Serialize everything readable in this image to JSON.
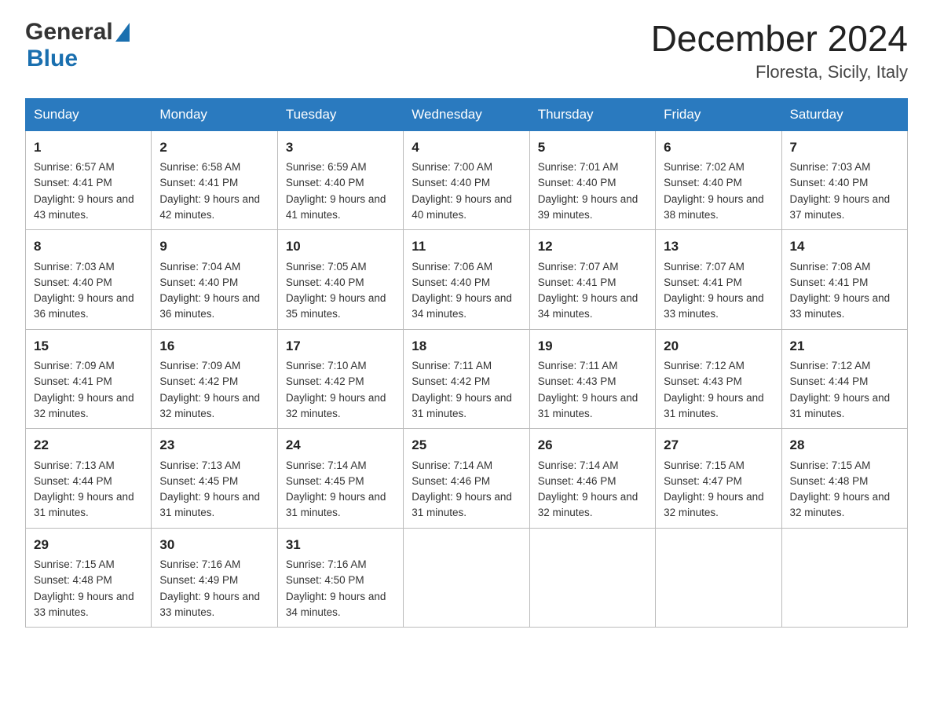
{
  "header": {
    "logo_general": "General",
    "logo_blue": "Blue",
    "month_year": "December 2024",
    "location": "Floresta, Sicily, Italy"
  },
  "days_of_week": [
    "Sunday",
    "Monday",
    "Tuesday",
    "Wednesday",
    "Thursday",
    "Friday",
    "Saturday"
  ],
  "weeks": [
    [
      {
        "day": "1",
        "sunrise": "Sunrise: 6:57 AM",
        "sunset": "Sunset: 4:41 PM",
        "daylight": "Daylight: 9 hours and 43 minutes."
      },
      {
        "day": "2",
        "sunrise": "Sunrise: 6:58 AM",
        "sunset": "Sunset: 4:41 PM",
        "daylight": "Daylight: 9 hours and 42 minutes."
      },
      {
        "day": "3",
        "sunrise": "Sunrise: 6:59 AM",
        "sunset": "Sunset: 4:40 PM",
        "daylight": "Daylight: 9 hours and 41 minutes."
      },
      {
        "day": "4",
        "sunrise": "Sunrise: 7:00 AM",
        "sunset": "Sunset: 4:40 PM",
        "daylight": "Daylight: 9 hours and 40 minutes."
      },
      {
        "day": "5",
        "sunrise": "Sunrise: 7:01 AM",
        "sunset": "Sunset: 4:40 PM",
        "daylight": "Daylight: 9 hours and 39 minutes."
      },
      {
        "day": "6",
        "sunrise": "Sunrise: 7:02 AM",
        "sunset": "Sunset: 4:40 PM",
        "daylight": "Daylight: 9 hours and 38 minutes."
      },
      {
        "day": "7",
        "sunrise": "Sunrise: 7:03 AM",
        "sunset": "Sunset: 4:40 PM",
        "daylight": "Daylight: 9 hours and 37 minutes."
      }
    ],
    [
      {
        "day": "8",
        "sunrise": "Sunrise: 7:03 AM",
        "sunset": "Sunset: 4:40 PM",
        "daylight": "Daylight: 9 hours and 36 minutes."
      },
      {
        "day": "9",
        "sunrise": "Sunrise: 7:04 AM",
        "sunset": "Sunset: 4:40 PM",
        "daylight": "Daylight: 9 hours and 36 minutes."
      },
      {
        "day": "10",
        "sunrise": "Sunrise: 7:05 AM",
        "sunset": "Sunset: 4:40 PM",
        "daylight": "Daylight: 9 hours and 35 minutes."
      },
      {
        "day": "11",
        "sunrise": "Sunrise: 7:06 AM",
        "sunset": "Sunset: 4:40 PM",
        "daylight": "Daylight: 9 hours and 34 minutes."
      },
      {
        "day": "12",
        "sunrise": "Sunrise: 7:07 AM",
        "sunset": "Sunset: 4:41 PM",
        "daylight": "Daylight: 9 hours and 34 minutes."
      },
      {
        "day": "13",
        "sunrise": "Sunrise: 7:07 AM",
        "sunset": "Sunset: 4:41 PM",
        "daylight": "Daylight: 9 hours and 33 minutes."
      },
      {
        "day": "14",
        "sunrise": "Sunrise: 7:08 AM",
        "sunset": "Sunset: 4:41 PM",
        "daylight": "Daylight: 9 hours and 33 minutes."
      }
    ],
    [
      {
        "day": "15",
        "sunrise": "Sunrise: 7:09 AM",
        "sunset": "Sunset: 4:41 PM",
        "daylight": "Daylight: 9 hours and 32 minutes."
      },
      {
        "day": "16",
        "sunrise": "Sunrise: 7:09 AM",
        "sunset": "Sunset: 4:42 PM",
        "daylight": "Daylight: 9 hours and 32 minutes."
      },
      {
        "day": "17",
        "sunrise": "Sunrise: 7:10 AM",
        "sunset": "Sunset: 4:42 PM",
        "daylight": "Daylight: 9 hours and 32 minutes."
      },
      {
        "day": "18",
        "sunrise": "Sunrise: 7:11 AM",
        "sunset": "Sunset: 4:42 PM",
        "daylight": "Daylight: 9 hours and 31 minutes."
      },
      {
        "day": "19",
        "sunrise": "Sunrise: 7:11 AM",
        "sunset": "Sunset: 4:43 PM",
        "daylight": "Daylight: 9 hours and 31 minutes."
      },
      {
        "day": "20",
        "sunrise": "Sunrise: 7:12 AM",
        "sunset": "Sunset: 4:43 PM",
        "daylight": "Daylight: 9 hours and 31 minutes."
      },
      {
        "day": "21",
        "sunrise": "Sunrise: 7:12 AM",
        "sunset": "Sunset: 4:44 PM",
        "daylight": "Daylight: 9 hours and 31 minutes."
      }
    ],
    [
      {
        "day": "22",
        "sunrise": "Sunrise: 7:13 AM",
        "sunset": "Sunset: 4:44 PM",
        "daylight": "Daylight: 9 hours and 31 minutes."
      },
      {
        "day": "23",
        "sunrise": "Sunrise: 7:13 AM",
        "sunset": "Sunset: 4:45 PM",
        "daylight": "Daylight: 9 hours and 31 minutes."
      },
      {
        "day": "24",
        "sunrise": "Sunrise: 7:14 AM",
        "sunset": "Sunset: 4:45 PM",
        "daylight": "Daylight: 9 hours and 31 minutes."
      },
      {
        "day": "25",
        "sunrise": "Sunrise: 7:14 AM",
        "sunset": "Sunset: 4:46 PM",
        "daylight": "Daylight: 9 hours and 31 minutes."
      },
      {
        "day": "26",
        "sunrise": "Sunrise: 7:14 AM",
        "sunset": "Sunset: 4:46 PM",
        "daylight": "Daylight: 9 hours and 32 minutes."
      },
      {
        "day": "27",
        "sunrise": "Sunrise: 7:15 AM",
        "sunset": "Sunset: 4:47 PM",
        "daylight": "Daylight: 9 hours and 32 minutes."
      },
      {
        "day": "28",
        "sunrise": "Sunrise: 7:15 AM",
        "sunset": "Sunset: 4:48 PM",
        "daylight": "Daylight: 9 hours and 32 minutes."
      }
    ],
    [
      {
        "day": "29",
        "sunrise": "Sunrise: 7:15 AM",
        "sunset": "Sunset: 4:48 PM",
        "daylight": "Daylight: 9 hours and 33 minutes."
      },
      {
        "day": "30",
        "sunrise": "Sunrise: 7:16 AM",
        "sunset": "Sunset: 4:49 PM",
        "daylight": "Daylight: 9 hours and 33 minutes."
      },
      {
        "day": "31",
        "sunrise": "Sunrise: 7:16 AM",
        "sunset": "Sunset: 4:50 PM",
        "daylight": "Daylight: 9 hours and 34 minutes."
      },
      null,
      null,
      null,
      null
    ]
  ]
}
